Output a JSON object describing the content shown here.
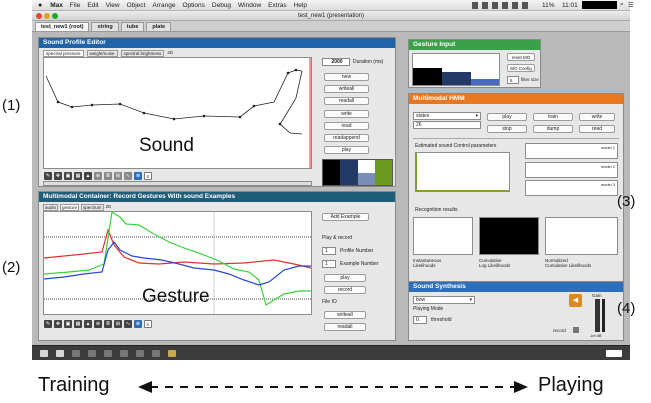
{
  "menubar": {
    "apple": "",
    "items": [
      "Max",
      "File",
      "Edit",
      "View",
      "Object",
      "Arrange",
      "Options",
      "Debug",
      "Window",
      "Extras",
      "Help"
    ],
    "battery": "11%",
    "clock": "11:01",
    "search_icon": "magnifier"
  },
  "window": {
    "title": "test_new1 (presentation)"
  },
  "tabs": [
    {
      "label": "test_new1 (root)"
    },
    {
      "label": "string"
    },
    {
      "label": "tube"
    },
    {
      "label": "plate"
    }
  ],
  "colors": {
    "blue_header": "#1f63a8",
    "teal_header": "#1f5d78",
    "green_header": "#3aa14a",
    "orange_header": "#e8781f",
    "synth_header": "#2b6fbf"
  },
  "sound_editor": {
    "title": "Sound Profile Editor",
    "subtabs": [
      "spectral pressure",
      "weight/noise",
      "spectral brightness",
      "2D"
    ],
    "duration_value": "2000",
    "duration_label": "Duration (ms)",
    "buttons": [
      "new",
      "writeall",
      "readall",
      "write",
      "read",
      "readappend",
      "play"
    ],
    "overlay": "Sound"
  },
  "gesture_container": {
    "title": "Multimodal Container: Record Gestures With sound Examples",
    "subtabs": [
      "audio",
      "gesture",
      "spectrum",
      "2D"
    ],
    "add_example": "Add Example",
    "play_record_label": "Play & record",
    "profile_number": "1",
    "profile_label": "Profile Number",
    "example_number": "1",
    "example_label": "Example Number",
    "play": "play",
    "record": "record",
    "file_io": "File IO",
    "writeall": "writeall",
    "readall": "readall",
    "overlay": "Gesture"
  },
  "gesture_input": {
    "title": "Gesture Input",
    "reset_label": "reset MO",
    "config_label": "MO Config",
    "filter_value": "6",
    "filter_label": "filter size"
  },
  "hmm": {
    "title": "Multimodal HMM",
    "states_label": "states",
    "states_value": "26",
    "buttons": {
      "play": "play",
      "train": "train",
      "write": "write",
      "stop": "stop",
      "dump": "dump",
      "read": "read"
    },
    "estimated_label": "Estimated sound Control parameters",
    "models": [
      "model 1",
      "model 2",
      "model 3"
    ],
    "recognition_label": "Recognition results",
    "likelihoods": [
      {
        "line1": "Instantaneous",
        "line2": "Likelihoods"
      },
      {
        "line1": "Cumulative",
        "line2": "Log Likelihoods"
      },
      {
        "line1": "Normalized",
        "line2": "Cumulative Likelihoods"
      }
    ]
  },
  "synth": {
    "title": "Sound Synthesis",
    "mode_value": "bow",
    "playing_mode": "Playing Mode",
    "threshold_value": "0.",
    "threshold_label": "threshold",
    "record_label": "record",
    "gain_label": "Gain",
    "db_label": "-inf dB",
    "speaker_icon": "speaker-icon"
  },
  "annotations": {
    "a1": "(1)",
    "a2": "(2)",
    "a3": "(3)",
    "a4": "(4)"
  },
  "footer": {
    "training": "Training",
    "playing": "Playing"
  }
}
